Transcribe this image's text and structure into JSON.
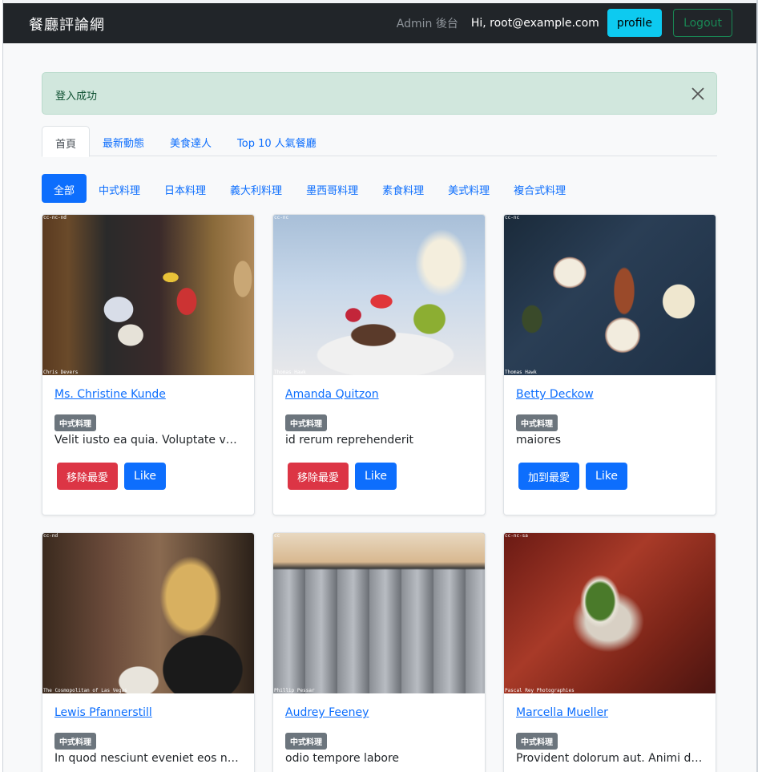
{
  "navbar": {
    "brand": "餐廳評論網",
    "admin_label": "Admin 後台",
    "greeting": "Hi, root@example.com",
    "profile_label": "profile",
    "logout_label": "Logout"
  },
  "alert": {
    "message": "登入成功",
    "close_icon": "close-icon"
  },
  "tabs": [
    {
      "label": "首頁",
      "active": true
    },
    {
      "label": "最新動態",
      "active": false
    },
    {
      "label": "美食達人",
      "active": false
    },
    {
      "label": "Top 10 人氣餐廳",
      "active": false
    }
  ],
  "categories": [
    {
      "label": "全部",
      "active": true
    },
    {
      "label": "中式料理",
      "active": false
    },
    {
      "label": "日本料理",
      "active": false
    },
    {
      "label": "義大利料理",
      "active": false
    },
    {
      "label": "墨西哥料理",
      "active": false
    },
    {
      "label": "素食料理",
      "active": false
    },
    {
      "label": "美式料理",
      "active": false
    },
    {
      "label": "複合式料理",
      "active": false
    }
  ],
  "restaurants": [
    {
      "name": "Ms. Christine Kunde",
      "category": "中式料理",
      "description": "Velit iusto ea quia. Voluptate voluptatem",
      "favorite_label": "移除最愛",
      "like_label": "Like",
      "photo_credit_top": "cc-nc-nd",
      "photo_credit_bottom": "Chris Devers"
    },
    {
      "name": "Amanda Quitzon",
      "category": "中式料理",
      "description": "id rerum reprehenderit",
      "favorite_label": "移除最愛",
      "like_label": "Like",
      "photo_credit_top": "cc-nc",
      "photo_credit_bottom": "Thomas Hawk"
    },
    {
      "name": "Betty Deckow",
      "category": "中式料理",
      "description": "maiores",
      "favorite_label": "加到最愛",
      "like_label": "Like",
      "photo_credit_top": "cc-nc",
      "photo_credit_bottom": "Thomas Hawk"
    },
    {
      "name": "Lewis Pfannerstill",
      "category": "中式料理",
      "description": "In quod nesciunt eveniet eos nulla",
      "photo_credit_top": "cc-nd",
      "photo_credit_bottom": "The Cosmopolitan of Las Vegas"
    },
    {
      "name": "Audrey Feeney",
      "category": "中式料理",
      "description": "odio tempore labore",
      "photo_credit_top": "cc",
      "photo_credit_bottom": "Phillip Pessar"
    },
    {
      "name": "Marcella Mueller",
      "category": "中式料理",
      "description": "Provident dolorum aut. Animi dolores",
      "photo_credit_top": "cc-nc-sa",
      "photo_credit_bottom": "Pascal Rey Photographies"
    }
  ]
}
